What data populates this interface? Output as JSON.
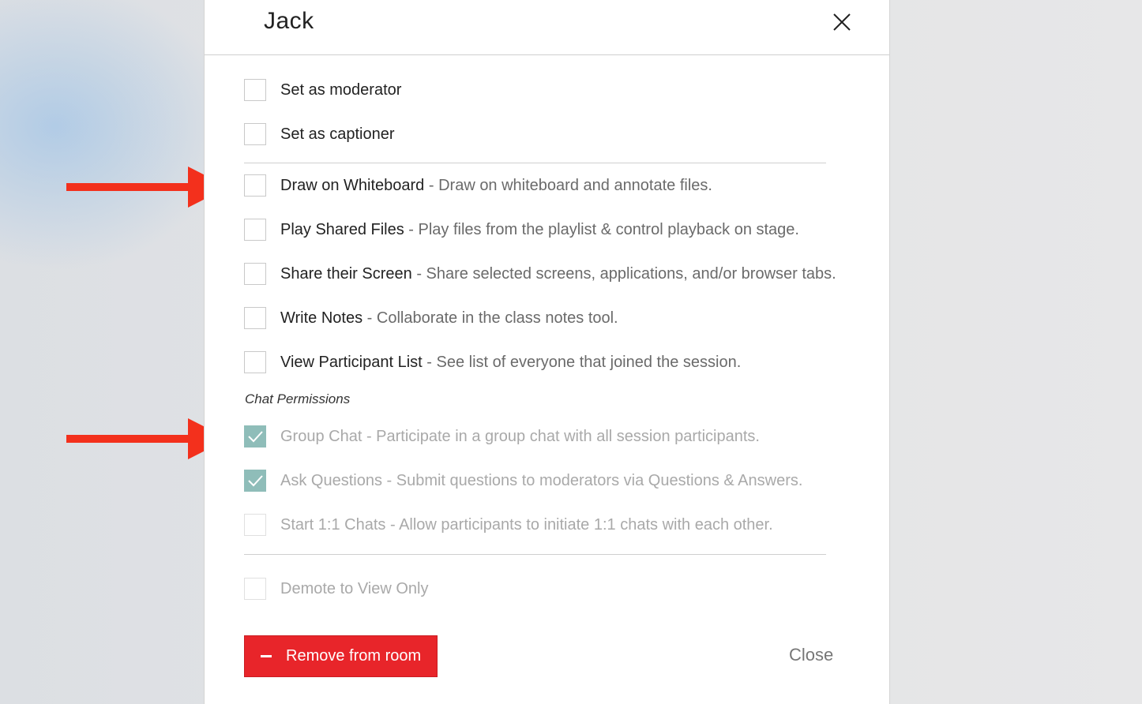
{
  "dialog": {
    "title": "Jack"
  },
  "roles": [
    {
      "label": "Set as moderator",
      "checked": false
    },
    {
      "label": "Set as captioner",
      "checked": false
    }
  ],
  "permissions": [
    {
      "label": "Draw on Whiteboard",
      "description": " - Draw on whiteboard and annotate files.",
      "checked": false
    },
    {
      "label": "Play Shared Files",
      "description": " - Play files from the playlist & control playback on stage.",
      "checked": false
    },
    {
      "label": "Share their Screen",
      "description": " - Share selected screens, applications, and/or browser tabs.",
      "checked": false
    },
    {
      "label": "Write Notes",
      "description": " - Collaborate in the class notes tool.",
      "checked": false
    },
    {
      "label": "View Participant List",
      "description": " - See list of everyone that joined the session.",
      "checked": false
    }
  ],
  "chat_permissions": {
    "heading": "Chat Permissions",
    "items": [
      {
        "label": "Group Chat",
        "description": " - Participate in a group chat with all session participants.",
        "checked": true
      },
      {
        "label": "Ask Questions",
        "description": " - Submit questions to moderators via Questions & Answers.",
        "checked": true
      },
      {
        "label": "Start 1:1 Chats",
        "description": " - Allow participants to initiate 1:1 chats with each other.",
        "checked": false
      }
    ]
  },
  "demote": {
    "label": "Demote to View Only",
    "checked": false
  },
  "actions": {
    "remove_label": "Remove from room",
    "close_label": "Close"
  },
  "colors": {
    "danger": "#e8252a",
    "check_teal": "#8fbdb9",
    "annotation_arrow": "#f3301c"
  }
}
